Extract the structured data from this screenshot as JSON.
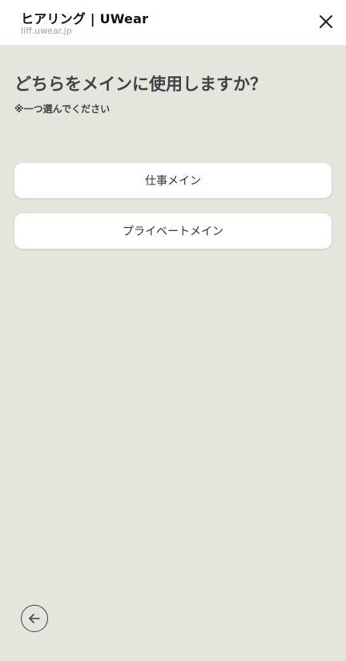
{
  "header": {
    "title": "ヒアリング | UWear",
    "url": "liff.uwear.jp",
    "close_icon": "close-icon"
  },
  "main": {
    "question": "どちらをメインに使用しますか？",
    "note": "※一つ選んでください",
    "options": [
      {
        "label": "仕事メイン"
      },
      {
        "label": "プライベートメイン"
      }
    ]
  },
  "footer": {
    "back_icon": "arrow-left-icon"
  },
  "colors": {
    "background": "#e6e5dd",
    "card": "#ffffff",
    "text": "#3d4347"
  }
}
